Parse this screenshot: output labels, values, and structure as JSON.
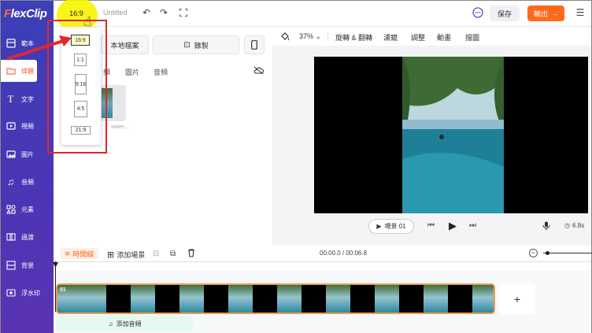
{
  "app": {
    "logo_accent": "F",
    "logo_rest": "lexClip",
    "title": "Untitled"
  },
  "topbar": {
    "ratio": "16:9",
    "save_label": "保存",
    "export_label": "輸出",
    "accent_color": "#ff6a1a"
  },
  "sidebar": {
    "items": [
      {
        "label": "範本",
        "icon": "template-icon"
      },
      {
        "label": "媒體",
        "icon": "media-folder-icon",
        "active": true
      },
      {
        "label": "文字",
        "icon": "text-icon"
      },
      {
        "label": "視頻",
        "icon": "video-icon"
      },
      {
        "label": "圖片",
        "icon": "image-icon"
      },
      {
        "label": "音頻",
        "icon": "music-icon"
      },
      {
        "label": "元素",
        "icon": "elements-icon"
      },
      {
        "label": "過渡",
        "icon": "transition-icon"
      },
      {
        "label": "背景",
        "icon": "background-icon"
      },
      {
        "label": "浮水印",
        "icon": "watermark-icon"
      }
    ]
  },
  "panel": {
    "local_files": "本地檔案",
    "record": "錄製",
    "tabs": [
      "圖片",
      "音頻"
    ],
    "partial_tab": "頻",
    "thumb_caption": "water..."
  },
  "ratio_menu": {
    "options": [
      "16:9",
      "1:1",
      "9:16",
      "4:5",
      "21:9"
    ],
    "selected": "16:9"
  },
  "preview_toolbar": {
    "zoom": "37%",
    "items": [
      "旋轉 & 翻轉",
      "濾鏡",
      "調整",
      "動畫",
      "擋圖"
    ]
  },
  "player": {
    "scene_label": "場景 01",
    "duration": "6.8s"
  },
  "timeline": {
    "tab_label": "時間線",
    "add_scene": "添加場景",
    "time": "00:00.0 / 00:06.8",
    "clip_number": "01",
    "add_audio": "添加音頻"
  }
}
